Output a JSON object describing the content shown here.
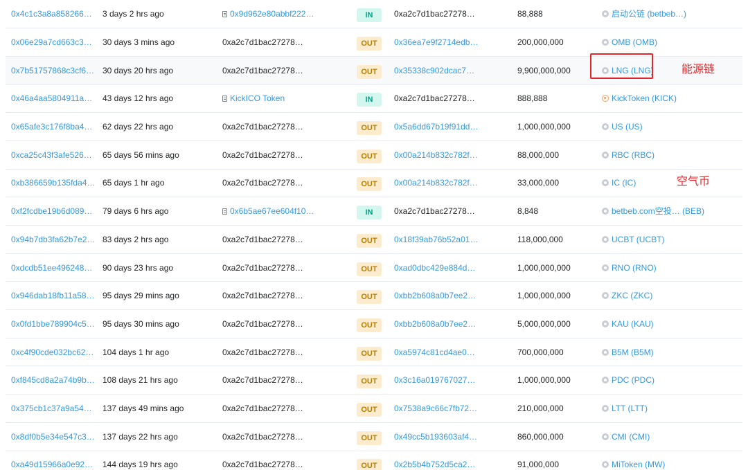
{
  "transactions": [
    {
      "hash": "0x4c1c3a8a858266…",
      "age": "3 days 2 hrs ago",
      "from": "0x9d962e80abbf222…",
      "from_is_contract": true,
      "from_is_link": true,
      "direction": "IN",
      "to": "0xa2c7d1bac27278…",
      "to_is_link": false,
      "value": "88,888",
      "token": "启动公链 (betbeb…)",
      "token_icon": "token-icon"
    },
    {
      "hash": "0x06e29a7cd663c3…",
      "age": "30 days 3 mins ago",
      "from": "0xa2c7d1bac27278…",
      "from_is_contract": false,
      "from_is_link": false,
      "direction": "OUT",
      "to": "0x36ea7e9f2714edb…",
      "to_is_link": true,
      "value": "200,000,000",
      "token": "OMB (OMB)",
      "token_icon": "token-icon"
    },
    {
      "hash": "0x7b51757868c3cf6…",
      "age": "30 days 20 hrs ago",
      "from": "0xa2c7d1bac27278…",
      "from_is_contract": false,
      "from_is_link": false,
      "direction": "OUT",
      "to": "0x35338c902dcac7…",
      "to_is_link": true,
      "value": "9,900,000,000",
      "token": "LNG (LNG)",
      "token_icon": "token-icon"
    },
    {
      "hash": "0x46a4aa5804911a…",
      "age": "43 days 12 hrs ago",
      "from": "KickICO Token",
      "from_is_contract": true,
      "from_is_link": true,
      "direction": "IN",
      "to": "0xa2c7d1bac27278…",
      "to_is_link": false,
      "value": "888,888",
      "token": "KickToken (KICK)",
      "token_icon": "kick-token-icon"
    },
    {
      "hash": "0x65afe3c176f8ba4…",
      "age": "62 days 22 hrs ago",
      "from": "0xa2c7d1bac27278…",
      "from_is_contract": false,
      "from_is_link": false,
      "direction": "OUT",
      "to": "0x5a6dd67b19f91dd…",
      "to_is_link": true,
      "value": "1,000,000,000",
      "token": "US (US)",
      "token_icon": "token-icon"
    },
    {
      "hash": "0xca25c43f3afe526…",
      "age": "65 days 56 mins ago",
      "from": "0xa2c7d1bac27278…",
      "from_is_contract": false,
      "from_is_link": false,
      "direction": "OUT",
      "to": "0x00a214b832c782f…",
      "to_is_link": true,
      "value": "88,000,000",
      "token": "RBC (RBC)",
      "token_icon": "token-icon"
    },
    {
      "hash": "0xb386659b135fda4…",
      "age": "65 days 1 hr ago",
      "from": "0xa2c7d1bac27278…",
      "from_is_contract": false,
      "from_is_link": false,
      "direction": "OUT",
      "to": "0x00a214b832c782f…",
      "to_is_link": true,
      "value": "33,000,000",
      "token": "IC (IC)",
      "token_icon": "token-icon"
    },
    {
      "hash": "0xf2fcdbe19b6d089…",
      "age": "79 days 6 hrs ago",
      "from": "0x6b5ae67ee604f10…",
      "from_is_contract": true,
      "from_is_link": true,
      "direction": "IN",
      "to": "0xa2c7d1bac27278…",
      "to_is_link": false,
      "value": "8,848",
      "token": "betbeb.com空投… (BEB)",
      "token_icon": "token-icon"
    },
    {
      "hash": "0x94b7db3fa62b7e2…",
      "age": "83 days 2 hrs ago",
      "from": "0xa2c7d1bac27278…",
      "from_is_contract": false,
      "from_is_link": false,
      "direction": "OUT",
      "to": "0x18f39ab76b52a01…",
      "to_is_link": true,
      "value": "118,000,000",
      "token": "UCBT (UCBT)",
      "token_icon": "token-icon"
    },
    {
      "hash": "0xdcdb51ee496248…",
      "age": "90 days 23 hrs ago",
      "from": "0xa2c7d1bac27278…",
      "from_is_contract": false,
      "from_is_link": false,
      "direction": "OUT",
      "to": "0xad0dbc429e884d…",
      "to_is_link": true,
      "value": "1,000,000,000",
      "token": "RNO (RNO)",
      "token_icon": "token-icon"
    },
    {
      "hash": "0x946dab18fb11a58…",
      "age": "95 days 29 mins ago",
      "from": "0xa2c7d1bac27278…",
      "from_is_contract": false,
      "from_is_link": false,
      "direction": "OUT",
      "to": "0xbb2b608a0b7ee2…",
      "to_is_link": true,
      "value": "1,000,000,000",
      "token": "ZKC (ZKC)",
      "token_icon": "token-icon"
    },
    {
      "hash": "0x0fd1bbe789904c5…",
      "age": "95 days 30 mins ago",
      "from": "0xa2c7d1bac27278…",
      "from_is_contract": false,
      "from_is_link": false,
      "direction": "OUT",
      "to": "0xbb2b608a0b7ee2…",
      "to_is_link": true,
      "value": "5,000,000,000",
      "token": "KAU (KAU)",
      "token_icon": "token-icon"
    },
    {
      "hash": "0xc4f90cde032bc62…",
      "age": "104 days 1 hr ago",
      "from": "0xa2c7d1bac27278…",
      "from_is_contract": false,
      "from_is_link": false,
      "direction": "OUT",
      "to": "0xa5974c81cd4ae0…",
      "to_is_link": true,
      "value": "700,000,000",
      "token": "B5M (B5M)",
      "token_icon": "token-icon"
    },
    {
      "hash": "0xf845cd8a2a74b9b…",
      "age": "108 days 21 hrs ago",
      "from": "0xa2c7d1bac27278…",
      "from_is_contract": false,
      "from_is_link": false,
      "direction": "OUT",
      "to": "0x3c16a019767027…",
      "to_is_link": true,
      "value": "1,000,000,000",
      "token": "PDC (PDC)",
      "token_icon": "token-icon"
    },
    {
      "hash": "0x375cb1c37a9a54…",
      "age": "137 days 49 mins ago",
      "from": "0xa2c7d1bac27278…",
      "from_is_contract": false,
      "from_is_link": false,
      "direction": "OUT",
      "to": "0x7538a9c66c7fb72…",
      "to_is_link": true,
      "value": "210,000,000",
      "token": "LTT (LTT)",
      "token_icon": "token-icon"
    },
    {
      "hash": "0x8df0b5e34e547c3…",
      "age": "137 days 22 hrs ago",
      "from": "0xa2c7d1bac27278…",
      "from_is_contract": false,
      "from_is_link": false,
      "direction": "OUT",
      "to": "0x49cc5b193603af4…",
      "to_is_link": true,
      "value": "860,000,000",
      "token": "CMI (CMI)",
      "token_icon": "token-icon"
    },
    {
      "hash": "0xa49d15966a0e92…",
      "age": "144 days 19 hrs ago",
      "from": "0xa2c7d1bac27278…",
      "from_is_contract": false,
      "from_is_link": false,
      "direction": "OUT",
      "to": "0x2b5b4b752d5ca2…",
      "to_is_link": true,
      "value": "91,000,000",
      "token": "MiToken (MW)",
      "token_icon": "token-icon"
    }
  ],
  "annotations": {
    "lng_label": "能源链",
    "air_label": "空气币"
  },
  "colors": {
    "link": "#3498db",
    "out_badge_bg": "#fcebcc",
    "out_badge_text": "#b47d00",
    "in_badge_bg": "#d3f6ee",
    "in_badge_text": "#00a186",
    "annotation_red": "#e3262b",
    "highlight_row": "#f8f9fa"
  }
}
